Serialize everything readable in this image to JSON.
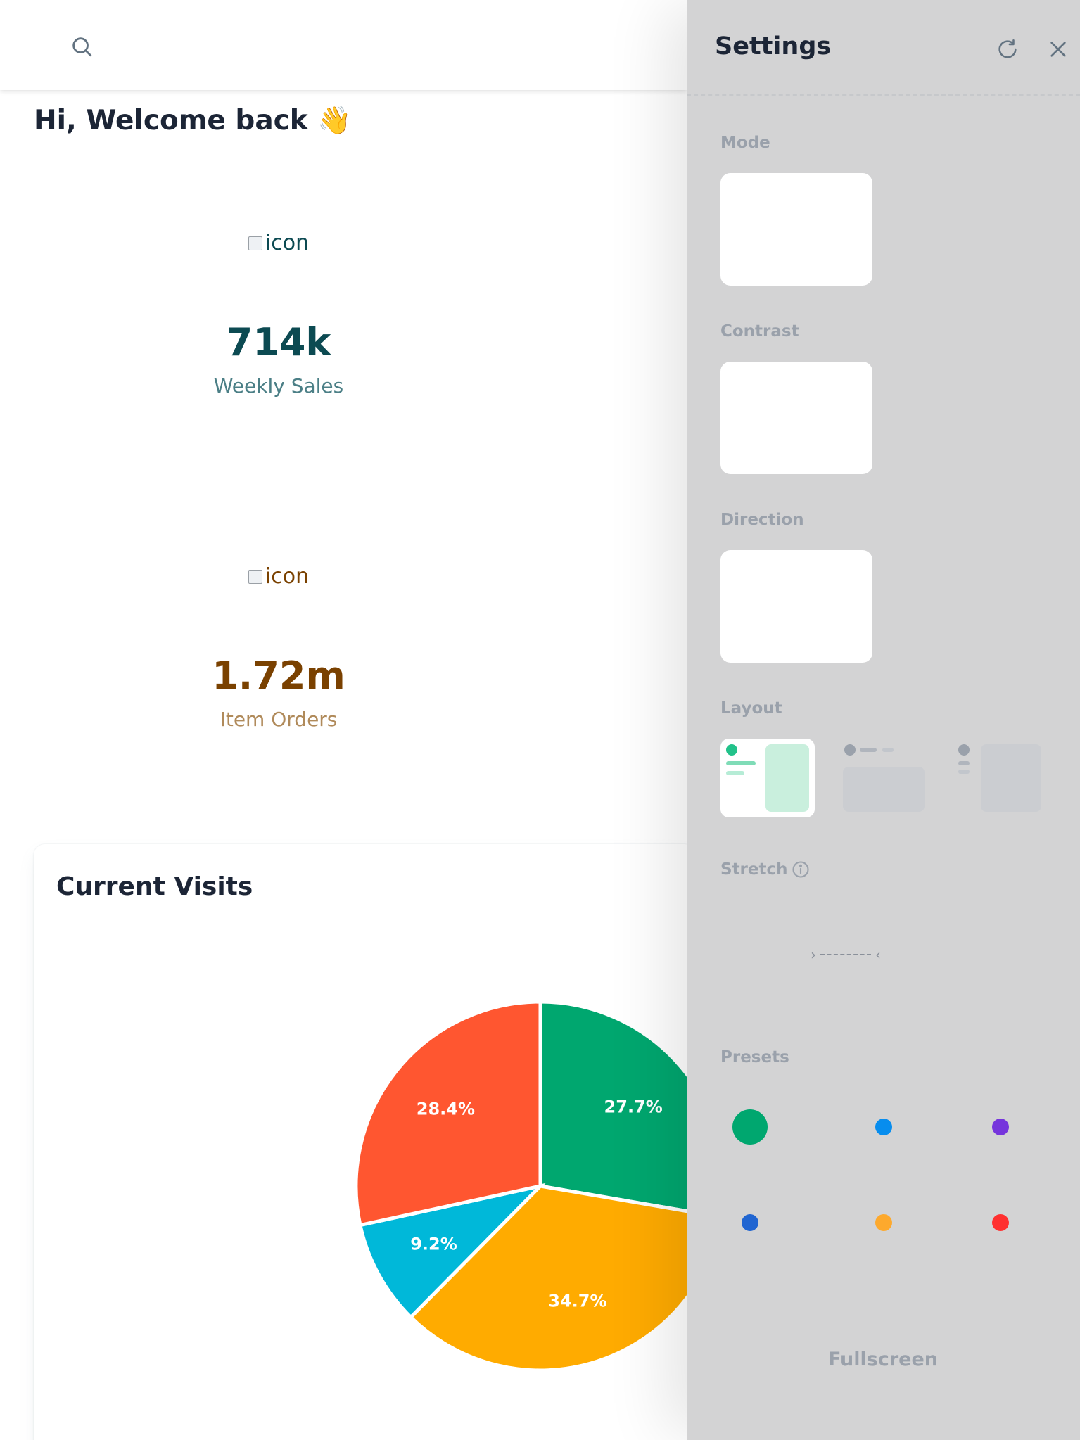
{
  "greeting": "Hi, Welcome back 👋",
  "stats": [
    {
      "icon_alt": "icon",
      "value": "714k",
      "label": "Weekly Sales"
    },
    {
      "icon_alt": "icon",
      "value": "1.72m",
      "label": "Item Orders"
    }
  ],
  "visits": {
    "title": "Current Visits"
  },
  "chart_data": {
    "type": "pie",
    "title": "Current Visits",
    "categories": [
      "",
      "",
      "",
      ""
    ],
    "values": [
      27.7,
      34.7,
      9.2,
      28.4
    ],
    "labels": [
      "27.7%",
      "34.7%",
      "9.2%",
      "28.4%"
    ],
    "colors": [
      "#00a76f",
      "#ffab00",
      "#00b8d9",
      "#ff5630"
    ]
  },
  "settings": {
    "title": "Settings",
    "sections": {
      "mode": "Mode",
      "contrast": "Contrast",
      "direction": "Direction",
      "layout": "Layout",
      "stretch": "Stretch",
      "presets": "Presets"
    },
    "layout_selected": "vertical",
    "presets": [
      "#00a76f",
      "#078dee",
      "#7635dc",
      "#2065d1",
      "#fda92d",
      "#ff3030"
    ],
    "presets_selected": 0,
    "fullscreen": "Fullscreen"
  }
}
